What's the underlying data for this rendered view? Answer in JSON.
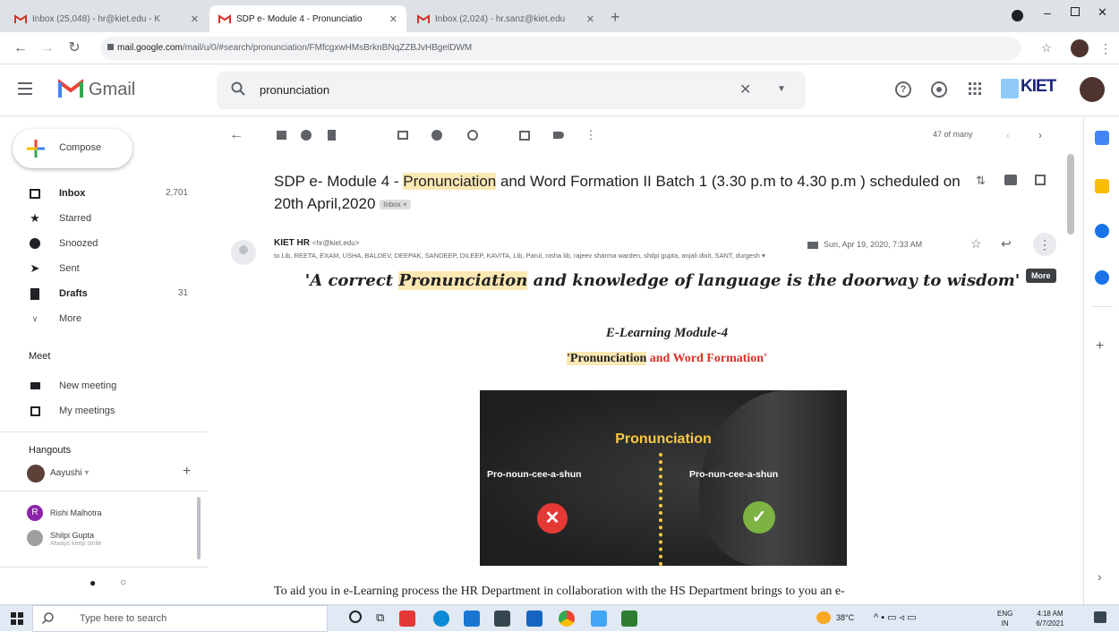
{
  "browser": {
    "tabs": [
      {
        "title": "Inbox (25,048) - hr@kiet.edu - K",
        "active": false
      },
      {
        "title": "SDP e- Module 4 - Pronunciatio",
        "active": true
      },
      {
        "title": "Inbox (2,024) - hr.sanz@kiet.edu",
        "active": false
      }
    ],
    "url_host": "mail.google.com",
    "url_path": "/mail/u/0/#search/pronunciation/FMfcgxwHMsBrknBNqZZBJvHBgelDWM"
  },
  "gmail": {
    "logo_text": "Gmail",
    "search_value": "pronunciation",
    "brand": "KIET"
  },
  "sidebar": {
    "compose": "Compose",
    "items": [
      {
        "label": "Inbox",
        "count": "2,701",
        "bold": true,
        "icon": "inbox-icon"
      },
      {
        "label": "Starred",
        "count": "",
        "bold": false,
        "icon": "star-icon"
      },
      {
        "label": "Snoozed",
        "count": "",
        "bold": false,
        "icon": "clock-icon"
      },
      {
        "label": "Sent",
        "count": "",
        "bold": false,
        "icon": "send-icon"
      },
      {
        "label": "Drafts",
        "count": "31",
        "bold": true,
        "icon": "draft-icon"
      },
      {
        "label": "More",
        "count": "",
        "bold": false,
        "icon": "chevron-down-icon"
      }
    ],
    "meet_title": "Meet",
    "meet_items": [
      "New meeting",
      "My meetings"
    ],
    "hangouts_title": "Hangouts",
    "hangouts_user": "Aayushi",
    "contacts": [
      {
        "name": "Rishi Malhotra",
        "status": "",
        "initial": "R",
        "color": "#8e24aa"
      },
      {
        "name": "Shilpi Gupta",
        "status": "Always keep smile",
        "initial": "S",
        "color": "#9e9e9e"
      }
    ]
  },
  "toolbar": {
    "count_text": "47 of many"
  },
  "message": {
    "subject_pre": "SDP e- Module 4 - ",
    "subject_hl": "Pronunciation",
    "subject_post": " and Word Formation II Batch 1 (3.30 p.m to 4.30 p.m ) scheduled on 20th April,2020",
    "label_chip": "Inbox ×",
    "sender_name": "KIET HR",
    "sender_email": "<hr@kiet.edu>",
    "date": "Sun, Apr 19, 2020, 7:33 AM",
    "recipients": "to Lib, REETA, EXAM, USHA, BALDEV, DEEPAK, SANDEEP, DILEEP, KAVITA, Lib, Parul, nisha lib, rajeev sharma warden, shilpi gupta, anjali dixit, SANT, durgesh",
    "more_tooltip": "More",
    "quote_pre": "'A correct ",
    "quote_hl": "Pronunciation",
    "quote_post": " and knowledge of language is the doorway to wisdom'",
    "module_title": "E-Learning Module-4",
    "module_sub_hl": "'Pronunciation",
    "module_sub_rest": " and Word Formation'",
    "image_title": "Pronunciation",
    "image_wrong": "Pro-noun-cee-a-shun",
    "image_right": "Pro-nun-cee-a-shun",
    "body_text": "To aid you in e-Learning process the HR Department in collaboration with the HS Department brings to you an e-"
  },
  "taskbar": {
    "search_placeholder": "Type here to search",
    "temp": "38°C",
    "lang1": "ENG",
    "lang2": "IN",
    "time": "4:18 AM",
    "date": "6/7/2021"
  }
}
